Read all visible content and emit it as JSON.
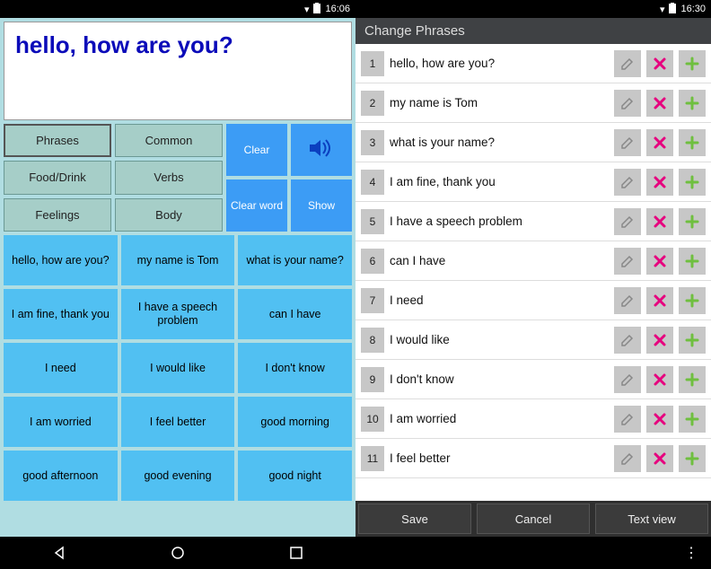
{
  "left": {
    "status_time": "16:06",
    "display_text": "hello, how are you?",
    "categories": [
      "Phrases",
      "Common",
      "Food/Drink",
      "Verbs",
      "Feelings",
      "Body"
    ],
    "actions": {
      "clear": "Clear",
      "clear_word": "Clear word",
      "show": "Show"
    },
    "phrases": [
      "hello, how are you?",
      "my name is Tom",
      "what is your name?",
      "I am fine, thank you",
      "I have a speech problem",
      "can I have",
      "I need",
      "I would like",
      "I don't know",
      "I am worried",
      "I feel better",
      "good morning",
      "good afternoon",
      "good evening",
      "good night"
    ]
  },
  "right": {
    "status_time": "16:30",
    "title": "Change Phrases",
    "rows": [
      {
        "n": "1",
        "t": "hello, how are you?"
      },
      {
        "n": "2",
        "t": "my name is Tom"
      },
      {
        "n": "3",
        "t": "what is your name?"
      },
      {
        "n": "4",
        "t": "I am fine, thank you"
      },
      {
        "n": "5",
        "t": "I have a speech problem"
      },
      {
        "n": "6",
        "t": "can I have"
      },
      {
        "n": "7",
        "t": "I need"
      },
      {
        "n": "8",
        "t": "I would like"
      },
      {
        "n": "9",
        "t": "I don't know"
      },
      {
        "n": "10",
        "t": "I am worried"
      },
      {
        "n": "11",
        "t": "I feel better"
      }
    ],
    "buttons": {
      "save": "Save",
      "cancel": "Cancel",
      "textview": "Text view"
    }
  },
  "icons": {
    "edit": "edit-icon",
    "delete": "delete-icon",
    "add": "add-icon",
    "speaker": "speaker-icon"
  }
}
